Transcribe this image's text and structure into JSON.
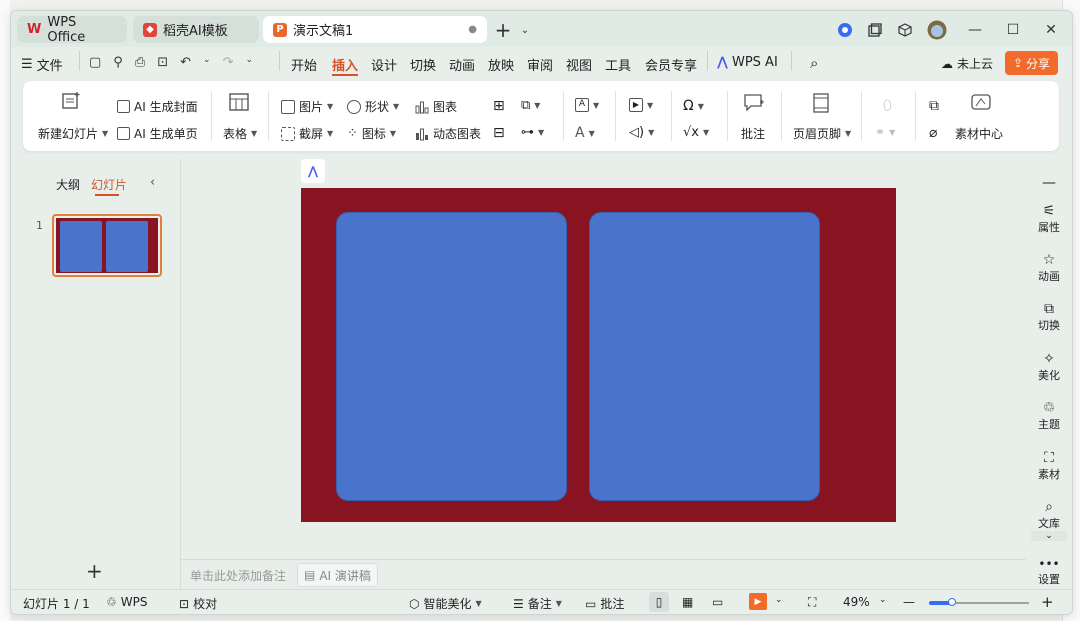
{
  "tabs": {
    "wps_office": "WPS Office",
    "template": "稻壳AI模板",
    "document": "演示文稿1"
  },
  "menu": {
    "file": "文件",
    "items": [
      "开始",
      "插入",
      "设计",
      "切换",
      "动画",
      "放映",
      "审阅",
      "视图",
      "工具",
      "会员专享"
    ],
    "active": "插入",
    "wps_ai": "WPS AI",
    "cloud": "未上云",
    "share": "分享"
  },
  "ribbon": {
    "new_slide": "新建幻灯片",
    "ai_cover": "AI 生成封面",
    "ai_single": "AI 生成单页",
    "table": "表格",
    "picture": "图片",
    "screenshot": "截屏",
    "shape": "形状",
    "icon": "图标",
    "chart": "图表",
    "dynamic_chart": "动态图表",
    "comment": "批注",
    "header_footer": "页眉页脚",
    "material_center": "素材中心"
  },
  "left_panel": {
    "outline": "大纲",
    "slides": "幻灯片",
    "slide_number": "1"
  },
  "notes": {
    "placeholder": "单击此处添加备注",
    "ai_speech": "AI 演讲稿"
  },
  "right_sidebar": [
    "属性",
    "动画",
    "切换",
    "美化",
    "主题",
    "素材",
    "文库",
    "设置"
  ],
  "status": {
    "slide_counter": "幻灯片 1 / 1",
    "theme": "WPS",
    "proofread": "校对",
    "smart_beautify": "智能美化",
    "notes": "备注",
    "comments": "批注",
    "zoom": "49%"
  },
  "colors": {
    "accent": "#e05a2b",
    "slide_bg": "#871420",
    "slide_box": "#4a74cb",
    "share_button": "#f26b2b"
  }
}
